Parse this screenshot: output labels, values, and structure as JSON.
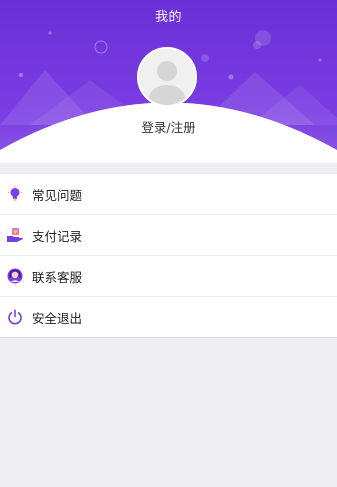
{
  "header": {
    "title": "我的",
    "login_label": "登录/注册"
  },
  "menu": {
    "items": [
      {
        "label": "常见问题",
        "icon": "lightbulb-icon"
      },
      {
        "label": "支付记录",
        "icon": "payment-hand-icon"
      },
      {
        "label": "联系客服",
        "icon": "customer-service-icon"
      },
      {
        "label": "安全退出",
        "icon": "power-icon"
      }
    ]
  },
  "colors": {
    "accent": "#6a2fd6",
    "background": "#eeeef2"
  }
}
